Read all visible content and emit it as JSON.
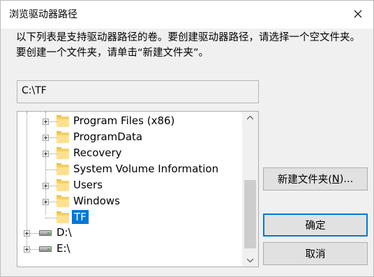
{
  "window": {
    "title": "浏览驱动器路径"
  },
  "instructions": "以下列表是支持驱动器路径的卷。要创建驱动器路径，请选择一个空文件夹。要创建一个文件夹，请单击“新建文件夹”。",
  "path_field": {
    "value": "C:\\TF"
  },
  "tree": {
    "folders": [
      {
        "label": "Program Files (x86)",
        "icon": "folder-icon"
      },
      {
        "label": "ProgramData",
        "icon": "folder-icon"
      },
      {
        "label": "Recovery",
        "icon": "folder-icon"
      },
      {
        "label": "System Volume Information",
        "icon": "folder-icon"
      },
      {
        "label": "Users",
        "icon": "folder-icon"
      },
      {
        "label": "Windows",
        "icon": "folder-icon"
      },
      {
        "label": "TF",
        "icon": "folder-icon",
        "selected": true
      }
    ],
    "drives": [
      {
        "label": "D:\\",
        "icon": "drive-icon"
      },
      {
        "label": "E:\\",
        "icon": "drive-icon"
      }
    ]
  },
  "buttons": {
    "new_folder_pre": "新建文件夹(",
    "new_folder_key": "N",
    "new_folder_post": ")...",
    "ok": "确定",
    "cancel": "取消"
  },
  "colors": {
    "selection": "#0078d7",
    "folder": "#ffe08d",
    "dialog_bg": "#f0f0f0"
  }
}
